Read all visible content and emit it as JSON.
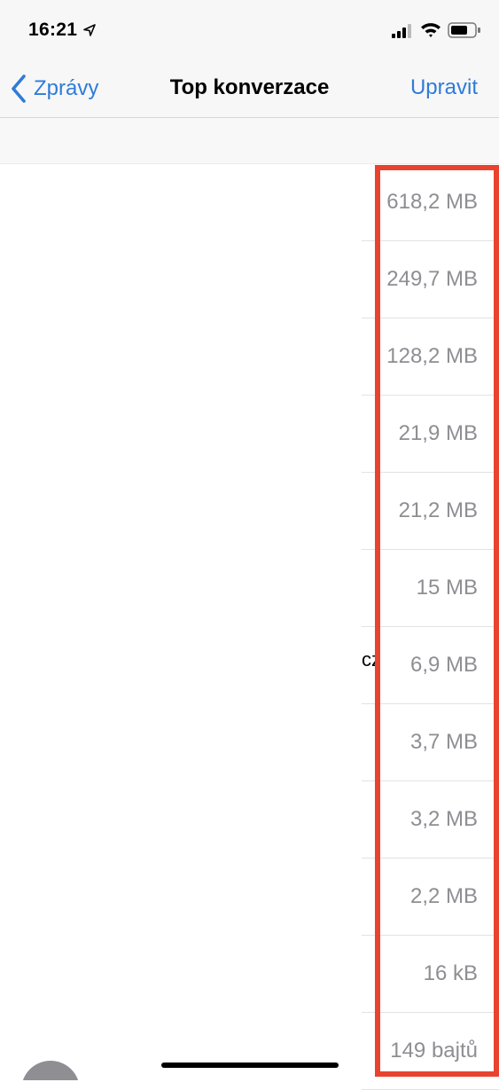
{
  "status_bar": {
    "time": "16:21"
  },
  "nav": {
    "back_label": "Zprávy",
    "title": "Top konverzace",
    "edit_label": "Upravit"
  },
  "rows": [
    {
      "size": "618,2 MB"
    },
    {
      "size": "249,7 MB"
    },
    {
      "size": "128,2 MB"
    },
    {
      "size": "21,9 MB"
    },
    {
      "size": "21,2 MB"
    },
    {
      "size": "15 MB"
    },
    {
      "size": "6,9 MB",
      "clipped_name": "cz"
    },
    {
      "size": "3,7 MB"
    },
    {
      "size": "3,2 MB"
    },
    {
      "size": "2,2 MB"
    },
    {
      "size": "16 kB"
    },
    {
      "size": "149 bajtů"
    }
  ],
  "colors": {
    "accent": "#2f7bd8",
    "highlight": "#e8432e",
    "secondary_text": "#8e8e93"
  }
}
